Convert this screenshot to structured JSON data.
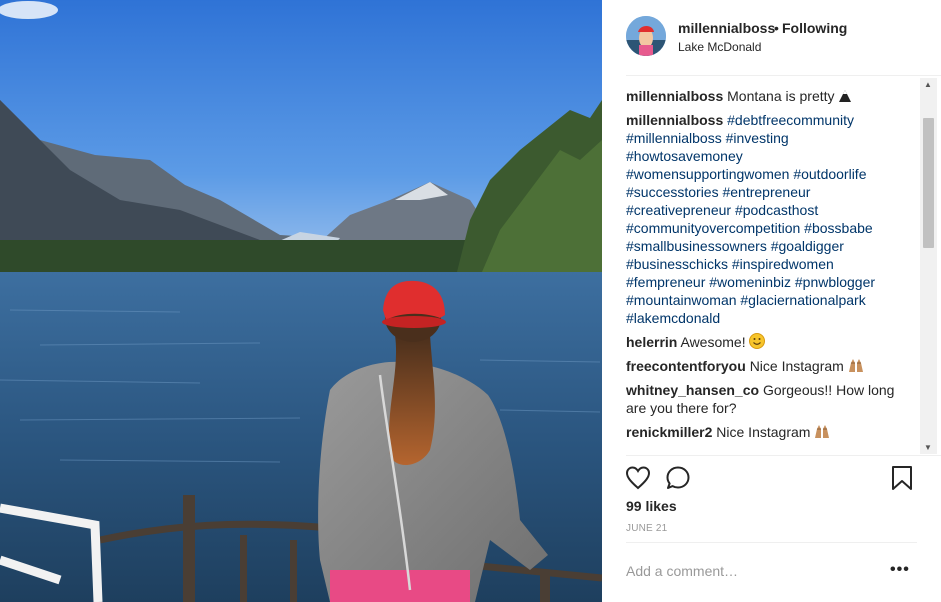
{
  "post": {
    "username": "millennialboss",
    "separator": "•",
    "follow_status": "Following",
    "location": "Lake McDonald"
  },
  "caption": {
    "username": "millennialboss",
    "text": "Montana is pretty ",
    "emoji": "mountain"
  },
  "hashtag_comment": {
    "username": "millennialboss",
    "lines": [
      "#debtfreecommunity",
      "#millennialboss #investing",
      "#howtosavemoney",
      "#womensupportingwomen #outdoorlife",
      "#successtories #entrepreneur",
      "#creativepreneur #podcasthost",
      "#communityovercompetition #bossbabe",
      "#smallbusinessowners #goaldigger",
      "#businesschicks #inspiredwomen",
      "#fempreneur #womeninbiz #pnwblogger",
      "#mountainwoman #glaciernationalpark",
      "#lakemcdonald"
    ]
  },
  "comments": [
    {
      "username": "helerrin",
      "text": "Awesome! ",
      "emoji": "smiley"
    },
    {
      "username": "freecontentforyou",
      "text": "Nice Instagram ",
      "emoji": "raised-hands"
    },
    {
      "username": "whitney_hansen_co",
      "text": "Gorgeous!! How long are you there for?",
      "emoji": ""
    },
    {
      "username": "renickmiller2",
      "text": "Nice Instagram ",
      "emoji": "raised-hands"
    },
    {
      "username": "...",
      "text": "",
      "emoji": ""
    }
  ],
  "likes": "99 likes",
  "date": "JUNE 21",
  "add_comment_placeholder": "Add a comment…",
  "more_options": "•••",
  "icons": {
    "like": "heart-icon",
    "comment": "comment-bubble-icon",
    "save": "bookmark-icon",
    "options": "more-options-icon"
  },
  "colors": {
    "hashtag": "#003569",
    "text": "#262626",
    "muted": "#999999",
    "divider": "#efefef"
  }
}
